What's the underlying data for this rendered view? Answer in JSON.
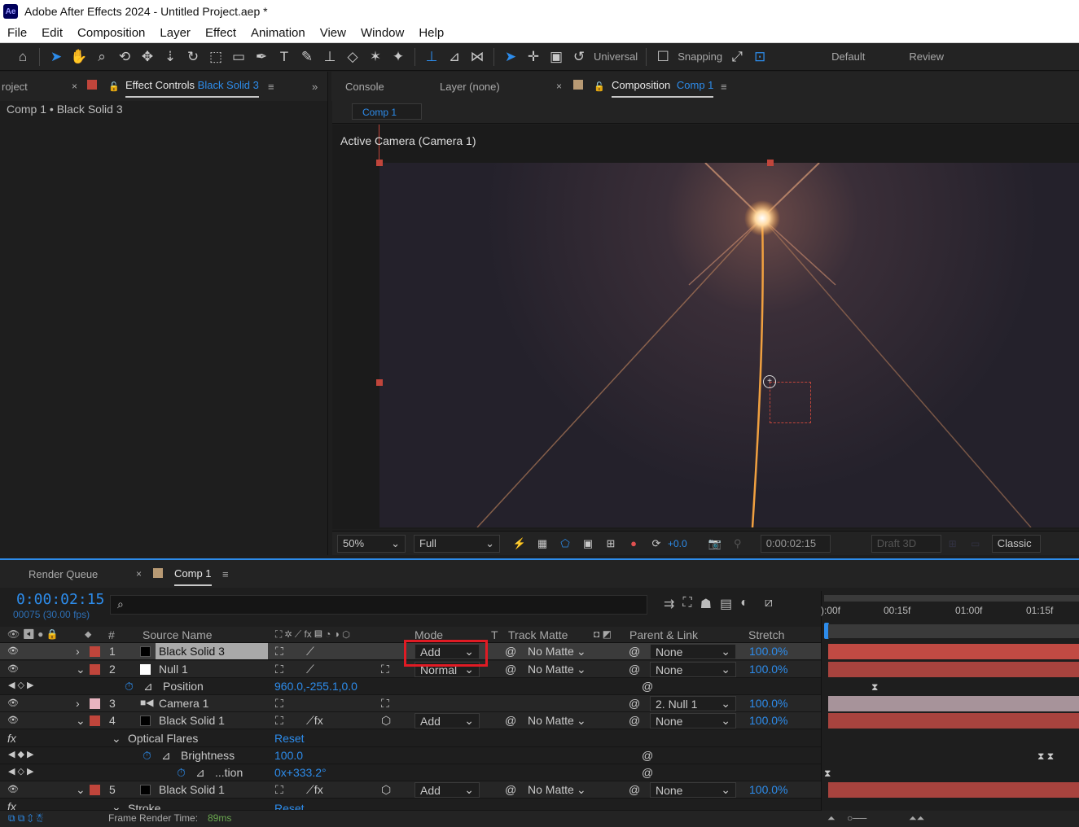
{
  "window": {
    "title": "Adobe After Effects 2024 - Untitled Project.aep *",
    "app_icon": "Ae"
  },
  "menu": [
    "File",
    "Edit",
    "Composition",
    "Layer",
    "Effect",
    "Animation",
    "View",
    "Window",
    "Help"
  ],
  "toolbar": {
    "universal": "Universal",
    "snapping": "Snapping",
    "workspace_default": "Default",
    "workspace_review": "Review"
  },
  "left_panel": {
    "project_tab": "roject",
    "effect_controls_tab": "Effect Controls",
    "effect_controls_layer": "Black Solid 3",
    "breadcrumb": "Comp 1 • Black Solid 3"
  },
  "right_panel": {
    "console_tab": "Console",
    "layer_tab": "Layer (none)",
    "composition_tab": "Composition",
    "composition_name": "Comp 1",
    "comp_chip": "Comp 1",
    "active_camera": "Active Camera (Camera 1)"
  },
  "viewer_controls": {
    "zoom": "50%",
    "resolution": "Full",
    "exposure": "+0.0",
    "timecode": "0:00:02:15",
    "draft3d": "Draft 3D",
    "renderer": "Classic"
  },
  "timeline": {
    "render_queue_tab": "Render Queue",
    "comp_tab": "Comp 1",
    "timecode": "0:00:02:15",
    "frames": "00075 (30.00 fps)",
    "headers": {
      "num": "#",
      "source": "Source Name",
      "mode": "Mode",
      "t": "T",
      "track_matte": "Track Matte",
      "parent": "Parent & Link",
      "stretch": "Stretch"
    },
    "ruler": [
      "):00f",
      "00:15f",
      "01:00f",
      "01:15f"
    ],
    "layers": [
      {
        "num": "1",
        "name": "Black Solid 3",
        "mode": "Add",
        "matte": "No Matte",
        "parent": "None",
        "stretch": "100.0%",
        "color": "#c0453b"
      },
      {
        "num": "2",
        "name": "Null 1",
        "mode": "Normal",
        "matte": "No Matte",
        "parent": "None",
        "stretch": "100.0%",
        "color": "#c0453b"
      },
      {
        "num": "3",
        "name": "Camera 1",
        "parent": "2. Null 1",
        "stretch": "100.0%",
        "color": "#e8b4c0"
      },
      {
        "num": "4",
        "name": "Black Solid 1",
        "mode": "Add",
        "matte": "No Matte",
        "parent": "None",
        "stretch": "100.0%",
        "color": "#c0453b"
      },
      {
        "num": "5",
        "name": "Black Solid 1",
        "mode": "Add",
        "matte": "No Matte",
        "parent": "None",
        "stretch": "100.0%",
        "color": "#c0453b"
      }
    ],
    "position": {
      "label": "Position",
      "value": "960.0,-255.1,0.0"
    },
    "optical_flares": {
      "label": "Optical Flares",
      "reset": "Reset"
    },
    "brightness": {
      "label": "Brightness",
      "value": "100.0"
    },
    "rotation": {
      "label": "...tion",
      "value": "0x+333.2°"
    },
    "stroke": {
      "label": "Stroke",
      "reset": "Reset"
    },
    "status": "Frame Render Time:",
    "render_time": "89ms"
  }
}
